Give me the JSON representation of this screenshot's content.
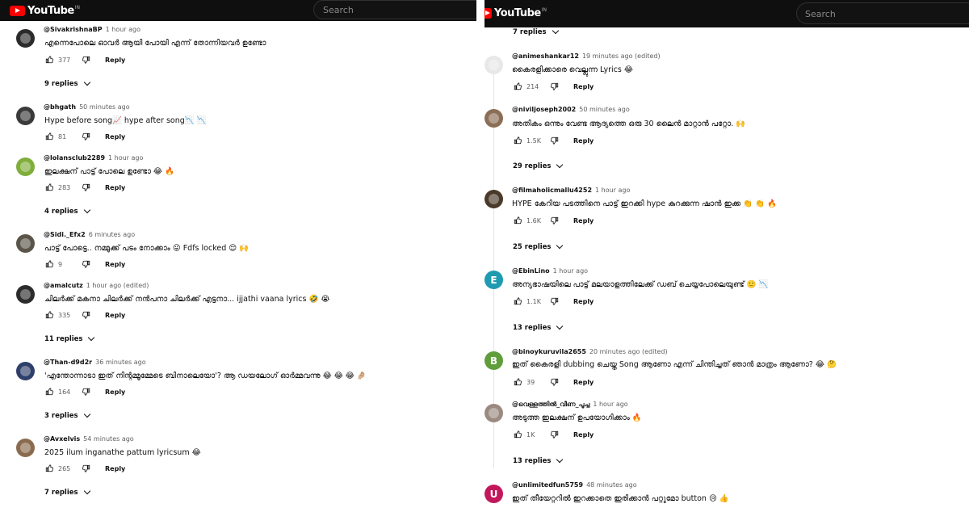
{
  "left": {
    "brand": "YouTube",
    "region": "IN",
    "search_placeholder": "Search",
    "comments": [
      {
        "handle": "@SivakrishnaBP",
        "time": "1 hour ago",
        "text": "എന്നെപോലെ ഓവർ ആയി പോയി എന്ന് തോന്നിയവർ ഉണ്ടോ",
        "likes": "377",
        "reply": "Reply",
        "replies": "9 replies",
        "avatar_color": "#2b2b2b",
        "avatar_letter": ""
      },
      {
        "handle": "@bhgath",
        "time": "50 minutes ago",
        "text": "Hype before song📈 hype after song📉 📉",
        "likes": "81",
        "reply": "Reply",
        "replies": "",
        "avatar_color": "#3a3a3a",
        "avatar_letter": ""
      },
      {
        "handle": "@lolansclub2289",
        "time": "1 hour ago",
        "text": "ഇലക്ഷന് പാട്ട് പോലെ ഉണ്ടോ 😂 🔥",
        "likes": "283",
        "reply": "Reply",
        "replies": "4 replies",
        "avatar_color": "#7fae3a",
        "avatar_letter": ""
      },
      {
        "handle": "@Sidi._Efx2",
        "time": "6 minutes ago",
        "text": "പാട്ട് പോട്ടെ.. നമ്മുക്ക് പടം നോക്കാം 😜 Fdfs locked 😌 🙌",
        "likes": "9",
        "reply": "Reply",
        "replies": "",
        "avatar_color": "#5a5548",
        "avatar_letter": ""
      },
      {
        "handle": "@amalcutz",
        "time": "1 hour ago (edited)",
        "text": "ചിലർക്ക് മകനാ ചിലർക്ക് നൻപനാ ചിലർക്ക് എട്ടനാ... ijjathi vaana lyrics 🤣 😭",
        "likes": "335",
        "reply": "Reply",
        "replies": "11 replies",
        "avatar_color": "#2c2c2c",
        "avatar_letter": ""
      },
      {
        "handle": "@Than-d9d2r",
        "time": "36 minutes ago",
        "text": "'എന്തോന്നാടാ ഇത് നിന്റമ്മൂമ്മേടെ ബിനാലെയോ'? ആ ഡയലോഗ് ഓർമ്മവന്നു 😂 😂 😂 🤌🏼",
        "likes": "164",
        "reply": "Reply",
        "replies": "3 replies",
        "avatar_color": "#2e3f6b",
        "avatar_letter": ""
      },
      {
        "handle": "@Avxelvis",
        "time": "54 minutes ago",
        "text": "2025 ilum inganathe pattum lyricsum 😂",
        "likes": "265",
        "reply": "Reply",
        "replies": "7 replies",
        "avatar_color": "#8a6b4e",
        "avatar_letter": ""
      }
    ]
  },
  "right": {
    "brand": "YouTube",
    "region": "IN",
    "search_placeholder": "Search",
    "top_replies": "7 replies",
    "comments": [
      {
        "handle": "@animeshankar12",
        "time": "19 minutes ago (edited)",
        "text": "കൈരളിക്കാരെ വെല്ലുന്ന  Lyrics 😂",
        "likes": "214",
        "reply": "Reply",
        "replies": "",
        "avatar_color": "#e8e8e8",
        "avatar_letter": ""
      },
      {
        "handle": "@niviljoseph2002",
        "time": "50 minutes ago",
        "text": "അതികം ഒന്നും വേണ്ട ആദ്യത്തെ ഒരു 30 ലൈൻ മാറ്റാൻ പറ്റോ. 🙌",
        "likes": "1.5K",
        "reply": "Reply",
        "replies": "29 replies",
        "avatar_color": "#8b6e55",
        "avatar_letter": ""
      },
      {
        "handle": "@filmaholicmallu4252",
        "time": "1 hour ago",
        "text": "HYPE കേറിയ പടത്തിനെ പാട്ട് ഇറക്കി hype കുറക്കുന്ന ഷാൻ ഇക്ക 👏 👏 🔥",
        "likes": "1.6K",
        "reply": "Reply",
        "replies": "25 replies",
        "avatar_color": "#4a3a2a",
        "avatar_letter": ""
      },
      {
        "handle": "@EbinLino",
        "time": "1 hour ago",
        "text": "അന്യഭാഷയിലെ പാട്ട് മലയാളത്തിലേക്ക് ഡബ് ചെയ്യപോലെയുണ്ട് 🙂 📉",
        "likes": "1.1K",
        "reply": "Reply",
        "replies": "13 replies",
        "avatar_color": "#1e9bb0",
        "avatar_letter": "E"
      },
      {
        "handle": "@binoykuruvila2655",
        "time": "20 minutes ago (edited)",
        "text": "ഇത് കൈരളി dubbing ചെയ്ത Song ആണോ എന്ന് ചിന്തിച്ചത് ഞാൻ മാത്രം ആണോ? 😂 🤔",
        "likes": "39",
        "reply": "Reply",
        "replies": "",
        "avatar_color": "#5f9e3b",
        "avatar_letter": "B"
      },
      {
        "handle": "@വെള്ളത്തിൽ_വീണ_പൂച്ച",
        "time": "1 hour ago",
        "text": "അടുത്ത ഇലക്ഷന് ഉപയോഗിക്കാം 🔥",
        "likes": "1K",
        "reply": "Reply",
        "replies": "13 replies",
        "avatar_color": "#9a8a80",
        "avatar_letter": ""
      },
      {
        "handle": "@unlimitedfun5759",
        "time": "48 minutes ago",
        "text": "ഇത് തീയേറ്ററിൽ ഇറക്കാതെ ഇരിക്കാൻ പറ്റുമോ button 😢 👍",
        "likes": "",
        "reply": "",
        "replies": "",
        "avatar_color": "#c2185b",
        "avatar_letter": "U"
      }
    ]
  }
}
